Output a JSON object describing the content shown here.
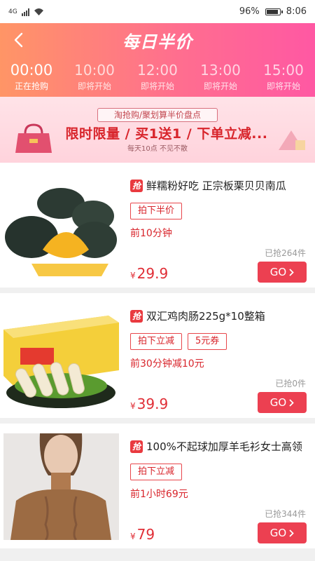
{
  "status_bar": {
    "network": "4G",
    "battery": "96%",
    "time": "8:06"
  },
  "header": {
    "title": "每日半价",
    "back_icon": "chevron-left-icon"
  },
  "time_tabs": [
    {
      "time": "00:00",
      "status": "正在抢购",
      "active": true
    },
    {
      "time": "10:00",
      "status": "即将开始",
      "active": false
    },
    {
      "time": "12:00",
      "status": "即将开始",
      "active": false
    },
    {
      "time": "13:00",
      "status": "即将开始",
      "active": false
    },
    {
      "time": "15:00",
      "status": "即将开始",
      "active": false
    }
  ],
  "banner": {
    "subtitle": "淘抢购/聚划算半价盘点",
    "headline": "限时限量 / 买1送1 / 下单立减...",
    "tagline": "每天10点 不见不散"
  },
  "products": [
    {
      "badge": "抢",
      "title": "鲜糯粉好吃 正宗板栗贝贝南瓜",
      "tags": [
        "拍下半价"
      ],
      "desc": "前10分钟",
      "sold": "已抢264件",
      "currency": "¥",
      "price": "29.9",
      "go_label": "GO"
    },
    {
      "badge": "抢",
      "title": "双汇鸡肉肠225g*10整箱",
      "tags": [
        "拍下立减",
        "5元券"
      ],
      "desc": "前30分钟减10元",
      "sold": "已抢0件",
      "currency": "¥",
      "price": "39.9",
      "go_label": "GO"
    },
    {
      "badge": "抢",
      "title": "100%不起球加厚羊毛衫女士高领",
      "tags": [
        "拍下立减"
      ],
      "desc": "前1小时69元",
      "sold": "已抢344件",
      "currency": "¥",
      "price": "79",
      "go_label": "GO"
    }
  ],
  "colors": {
    "accent_red": "#ec4051",
    "header_gradient_start": "#ff9566",
    "header_gradient_end": "#ff58a3"
  }
}
